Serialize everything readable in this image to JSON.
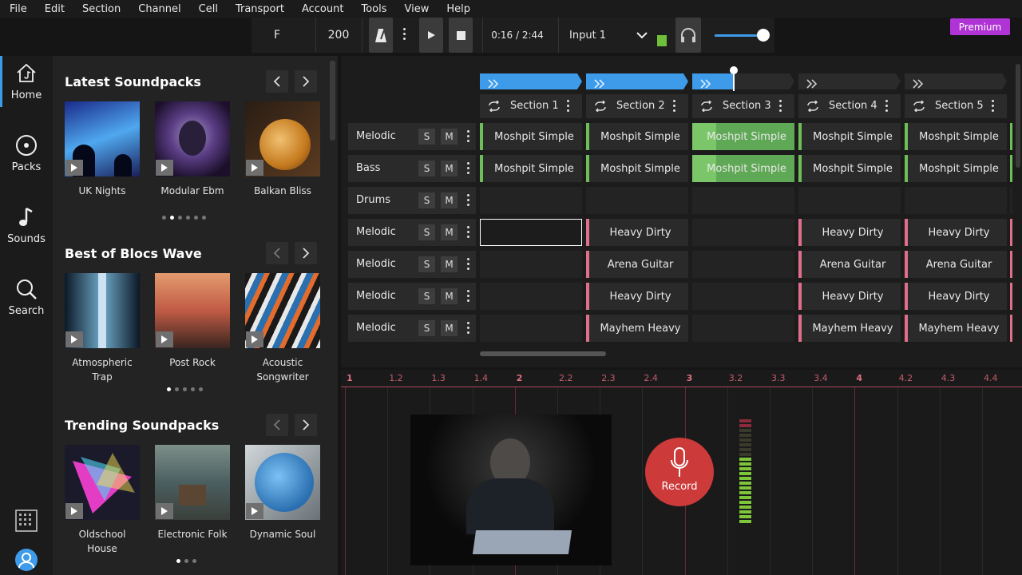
{
  "menu": [
    "File",
    "Edit",
    "Section",
    "Channel",
    "Cell",
    "Transport",
    "Account",
    "Tools",
    "View",
    "Help"
  ],
  "transport": {
    "key": "F",
    "bpm": "200",
    "time": "0:16 / 2:44",
    "input": "Input 1"
  },
  "premium": "Premium",
  "nav": [
    {
      "label": "Home",
      "icon": "home-icon"
    },
    {
      "label": "Packs",
      "icon": "packs-icon"
    },
    {
      "label": "Sounds",
      "icon": "note-icon"
    },
    {
      "label": "Search",
      "icon": "search-icon"
    }
  ],
  "browser": {
    "latest": {
      "title": "Latest Soundpacks",
      "items": [
        "UK Nights",
        "Modular Ebm",
        "Balkan Bliss"
      ]
    },
    "best": {
      "title": "Best of Blocs Wave",
      "items": [
        "Atmospheric Trap",
        "Post Rock",
        "Acoustic Songwriter"
      ]
    },
    "trending": {
      "title": "Trending Soundpacks",
      "items": [
        "Oldschool House",
        "Electronic Folk",
        "Dynamic Soul"
      ]
    }
  },
  "sections": [
    "Section 1",
    "Section 2",
    "Section 3",
    "Section 4",
    "Section 5"
  ],
  "tracks": [
    {
      "name": "Melodic",
      "cells": [
        "Moshpit Simple",
        "Moshpit Simple",
        "Moshpit Simple",
        "Moshpit Simple",
        "Moshpit Simple"
      ]
    },
    {
      "name": "Bass",
      "cells": [
        "Moshpit Simple",
        "Moshpit Simple",
        "Moshpit Simple",
        "Moshpit Simple",
        "Moshpit Simple"
      ]
    },
    {
      "name": "Drums",
      "cells": [
        "",
        "",
        "",
        "",
        ""
      ]
    },
    {
      "name": "Melodic",
      "cells": [
        "",
        "Heavy Dirty",
        "",
        "Heavy Dirty",
        "Heavy Dirty"
      ]
    },
    {
      "name": "Melodic",
      "cells": [
        "",
        "Arena Guitar",
        "",
        "Arena Guitar",
        "Arena Guitar"
      ]
    },
    {
      "name": "Melodic",
      "cells": [
        "",
        "Heavy Dirty",
        "",
        "Heavy Dirty",
        "Heavy Dirty"
      ]
    },
    {
      "name": "Melodic",
      "cells": [
        "",
        "Mayhem Heavy",
        "",
        "Mayhem Heavy",
        "Mayhem Heavy"
      ]
    }
  ],
  "solo": "S",
  "mute": "M",
  "ruler": [
    "1",
    "1.2",
    "1.3",
    "1.4",
    "2",
    "2.2",
    "2.3",
    "2.4",
    "3",
    "3.2",
    "3.3",
    "3.4",
    "4",
    "4.2",
    "4.3",
    "4.4"
  ],
  "record": "Record",
  "colors": {
    "accent": "#3d9be9",
    "green": "#6fbf58",
    "pink": "#e0708a",
    "record": "#cc3a3a",
    "premium": "#b034d5"
  }
}
